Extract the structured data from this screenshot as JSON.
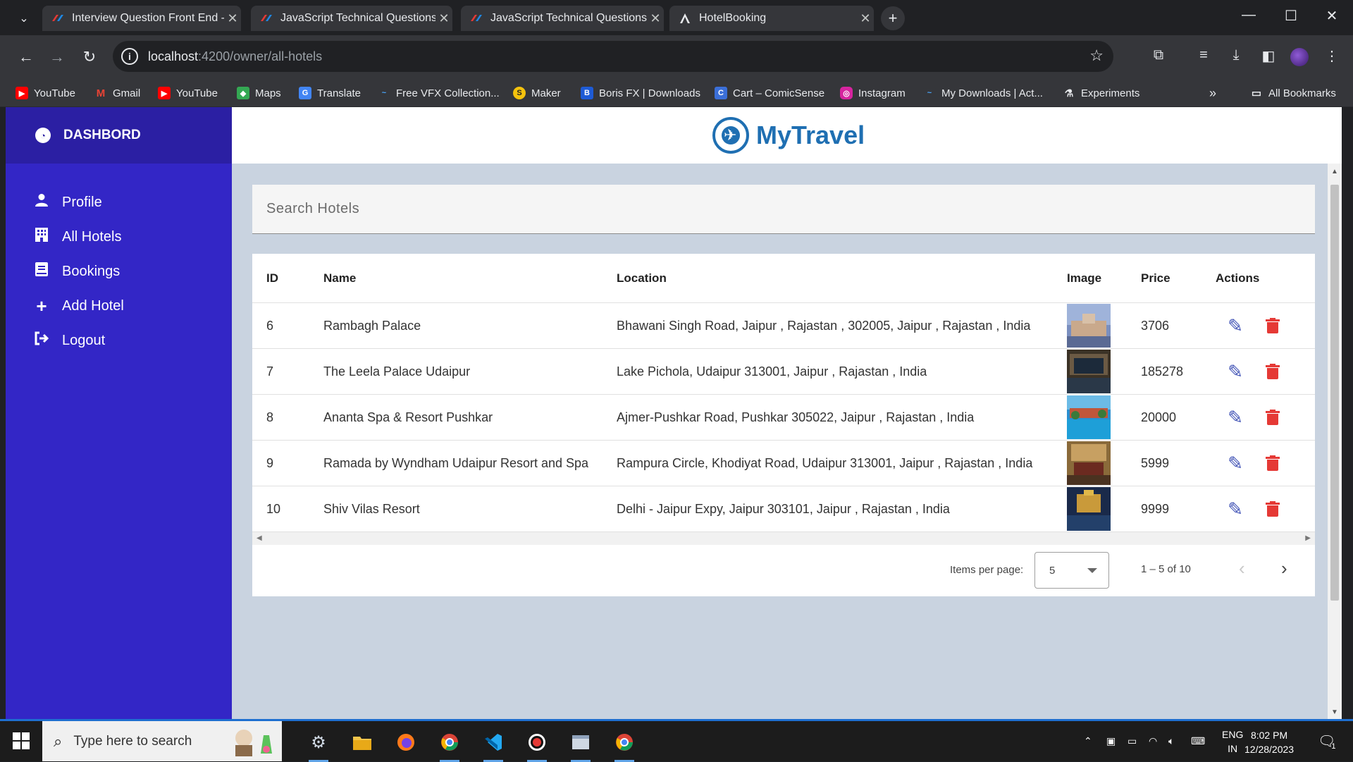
{
  "browser": {
    "tabs": [
      {
        "title": "Interview Question Front End -",
        "active": false
      },
      {
        "title": "JavaScript Technical Questions -",
        "active": false
      },
      {
        "title": "JavaScript Technical Questions -",
        "active": false
      },
      {
        "title": "HotelBooking",
        "active": true
      }
    ],
    "url_host": "localhost",
    "url_rest": ":4200/owner/all-hotels",
    "bookmarks": [
      "YouTube",
      "Gmail",
      "YouTube",
      "Maps",
      "Translate",
      "Free VFX Collection...",
      "Maker",
      "Boris FX | Downloads",
      "Cart – ComicSense",
      "Instagram",
      "My Downloads | Act...",
      "Experiments"
    ],
    "all_bookmarks": "All Bookmarks"
  },
  "sidebar": {
    "title": "DASHBORD",
    "items": [
      {
        "label": "Profile",
        "icon": "user-icon"
      },
      {
        "label": "All Hotels",
        "icon": "building-icon"
      },
      {
        "label": "Bookings",
        "icon": "book-icon"
      },
      {
        "label": "Add Hotel",
        "icon": "plus-icon"
      },
      {
        "label": "Logout",
        "icon": "logout-icon"
      }
    ]
  },
  "header": {
    "brand": "MyTravel"
  },
  "search": {
    "placeholder": "Search Hotels"
  },
  "table": {
    "headers": {
      "id": "ID",
      "name": "Name",
      "location": "Location",
      "image": "Image",
      "price": "Price",
      "actions": "Actions"
    },
    "rows": [
      {
        "id": "6",
        "name": "Rambagh Palace",
        "location": "Bhawani Singh Road, Jaipur , Rajastan , 302005, Jaipur , Rajastan , India",
        "price": "3706"
      },
      {
        "id": "7",
        "name": "The Leela Palace Udaipur",
        "location": "Lake Pichola, Udaipur 313001, Jaipur , Rajastan , India",
        "price": "185278"
      },
      {
        "id": "8",
        "name": "Ananta Spa & Resort Pushkar",
        "location": "Ajmer-Pushkar Road, Pushkar 305022, Jaipur , Rajastan , India",
        "price": "20000"
      },
      {
        "id": "9",
        "name": "Ramada by Wyndham Udaipur Resort and Spa",
        "location": "Rampura Circle, Khodiyat Road, Udaipur 313001, Jaipur , Rajastan , India",
        "price": "5999"
      },
      {
        "id": "10",
        "name": "Shiv Vilas Resort",
        "location": "Delhi - Jaipur Expy, Jaipur 303101, Jaipur , Rajastan , India",
        "price": "9999"
      }
    ]
  },
  "pager": {
    "label": "Items per page:",
    "per_page": "5",
    "range": "1 – 5 of 10"
  },
  "taskbar": {
    "search_placeholder": "Type here to search",
    "lang1": "ENG",
    "lang2": "IN",
    "time": "8:02 PM",
    "date": "12/28/2023",
    "notifications": "1"
  },
  "colors": {
    "sidebar": "#3326c6",
    "sidebar_head": "#2b1fa3",
    "brand": "#1f6fb2",
    "edit": "#3f51b5",
    "delete": "#e53935"
  }
}
